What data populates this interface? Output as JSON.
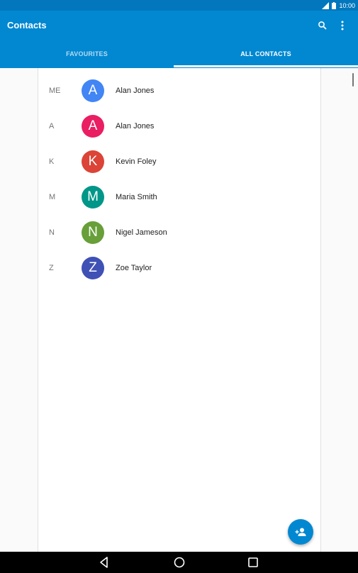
{
  "status_bar": {
    "time": "10:00"
  },
  "app_bar": {
    "title": "Contacts"
  },
  "tabs": [
    {
      "label": "FAVOURITES",
      "selected": false
    },
    {
      "label": "ALL CONTACTS",
      "selected": true
    }
  ],
  "contacts": [
    {
      "section": "ME",
      "initial": "A",
      "name": "Alan Jones",
      "color": "#4285f4"
    },
    {
      "section": "A",
      "initial": "A",
      "name": "Alan Jones",
      "color": "#e91e63"
    },
    {
      "section": "K",
      "initial": "K",
      "name": "Kevin Foley",
      "color": "#db4437"
    },
    {
      "section": "M",
      "initial": "M",
      "name": "Maria Smith",
      "color": "#009688"
    },
    {
      "section": "N",
      "initial": "N",
      "name": "Nigel Jameson",
      "color": "#689f38"
    },
    {
      "section": "Z",
      "initial": "Z",
      "name": "Zoe Taylor",
      "color": "#3f51b5"
    }
  ],
  "colors": {
    "primary": "#0288d1",
    "primary_dark": "#0277bd"
  },
  "icons": {
    "search": "search-icon",
    "more": "more-vert-icon",
    "add_contact": "add-person-icon",
    "back": "back-icon",
    "home": "home-icon",
    "recents": "recents-icon",
    "signal": "signal-icon",
    "battery": "battery-icon"
  }
}
